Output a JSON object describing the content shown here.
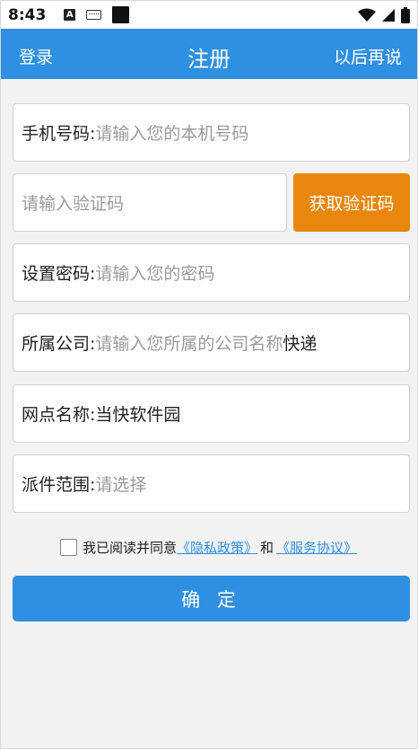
{
  "status_bar": {
    "time": "8:43",
    "icons": [
      "a-notification-icon",
      "keyboard-icon",
      "square-notification-icon",
      "wifi-icon",
      "signal-icon",
      "battery-icon"
    ]
  },
  "app_bar": {
    "left_label": "登录",
    "title": "注册",
    "right_label": "以后再说",
    "color": "#2f8fe0"
  },
  "form": {
    "phone": {
      "label": "手机号码:",
      "placeholder": "请输入您的本机号码"
    },
    "verify_code": {
      "placeholder": "请输入验证码",
      "button_label": "获取验证码",
      "button_color": "#e8870c"
    },
    "password": {
      "label": "设置密码:",
      "placeholder": "请输入您的密码"
    },
    "company": {
      "label": "所属公司:",
      "placeholder": "请输入您所属的公司名称",
      "value": "快递"
    },
    "branch": {
      "label": "网点名称:",
      "value": "当快软件园"
    },
    "delivery_range": {
      "label": "派件范围:",
      "placeholder": "请选择"
    }
  },
  "agreement": {
    "text": "我已阅读并同意",
    "privacy_link": "《隐私政策》",
    "and_text": "和",
    "service_link": "《服务协议》"
  },
  "confirm_label": "确 定"
}
